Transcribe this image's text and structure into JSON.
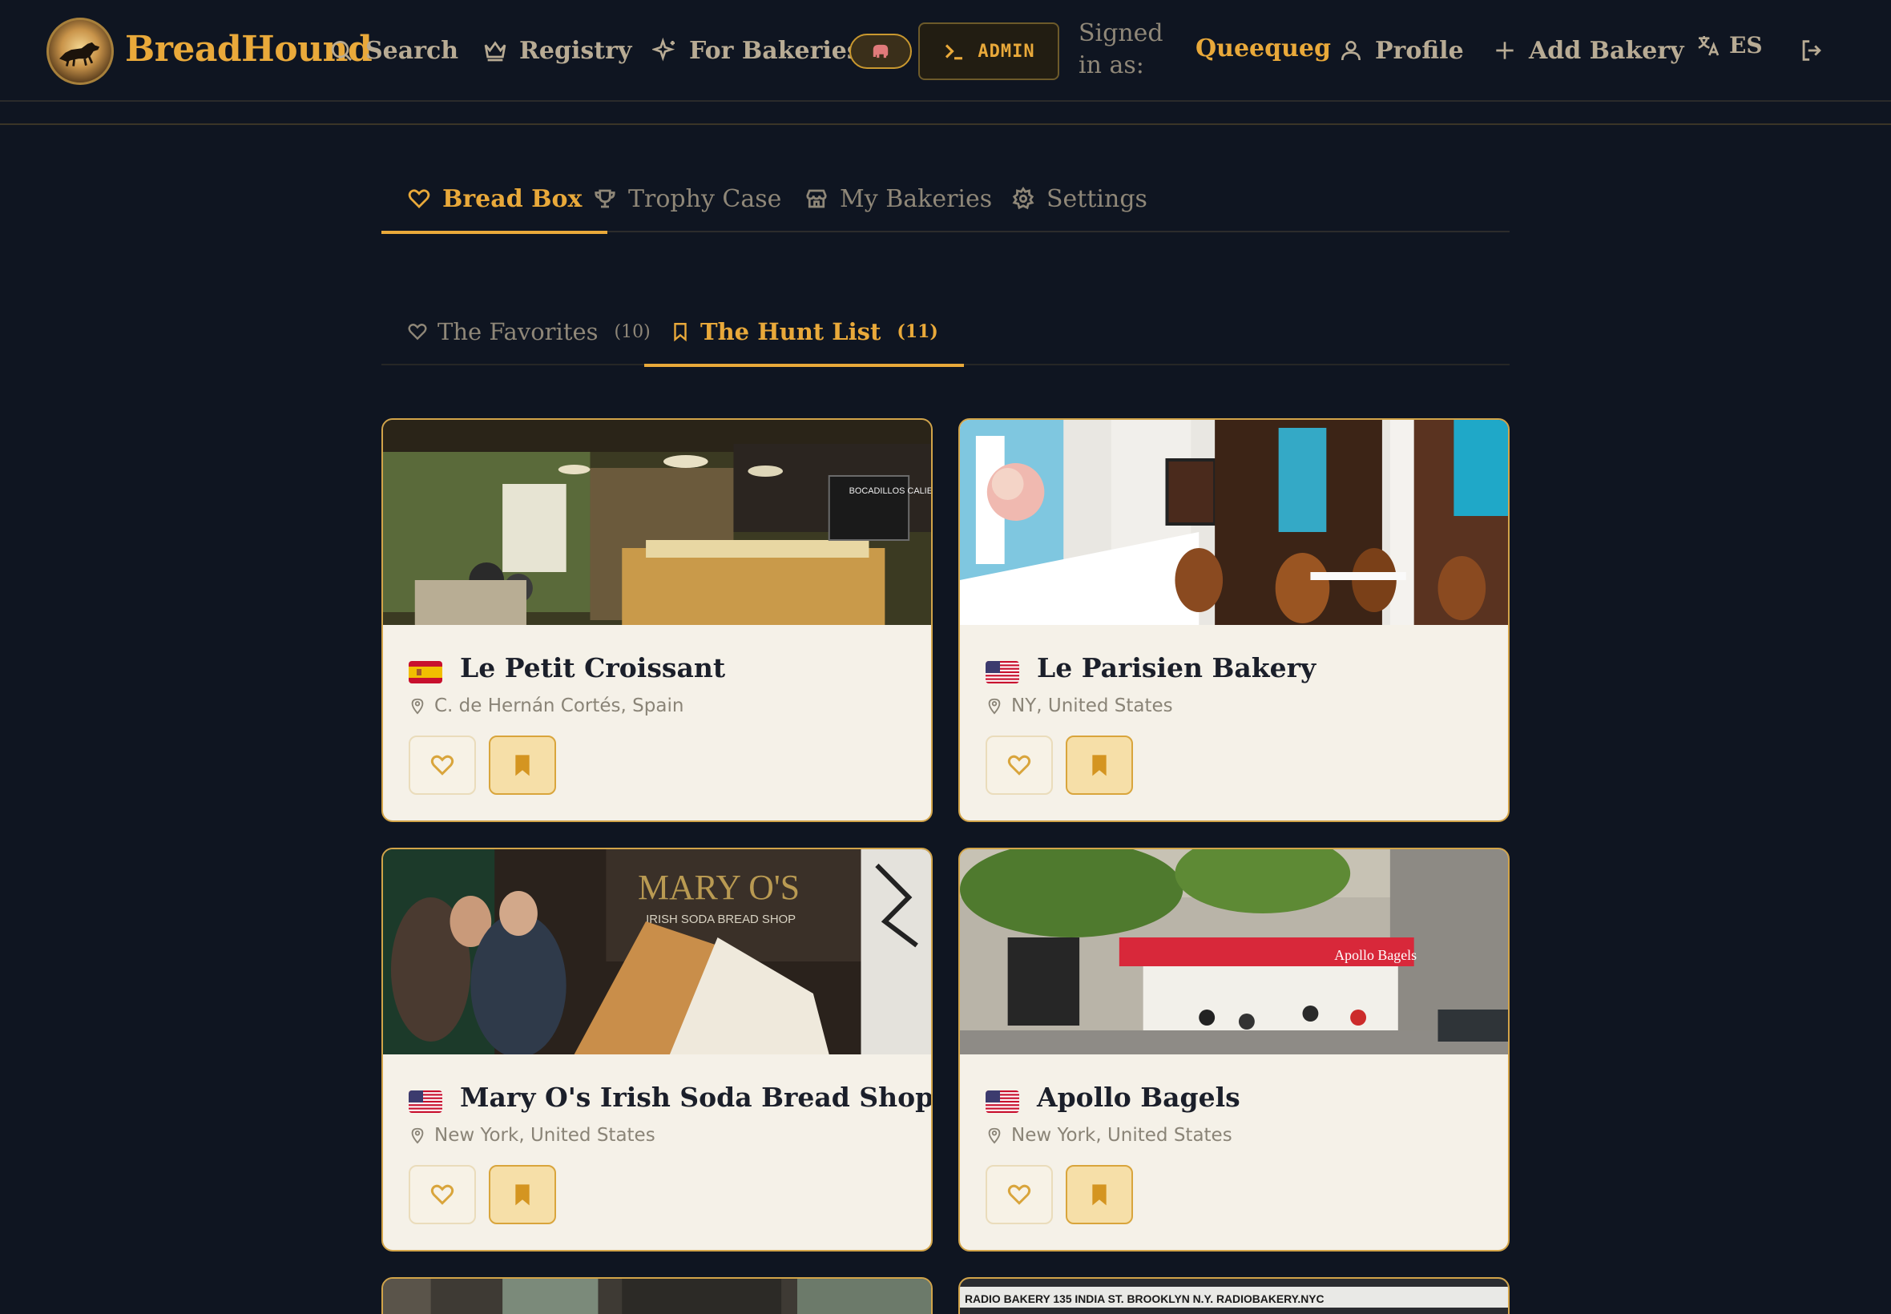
{
  "app": {
    "brand": "BreadHound",
    "accent": "#e9a93a",
    "bg": "#0f1521"
  },
  "nav": {
    "search": "Search",
    "registry": "Registry",
    "for_bakeries": "For Bakeries",
    "admin": "ADMIN",
    "signed_in_label": "Signed in as:",
    "username": "Queequeg",
    "profile": "Profile",
    "add_bakery": "Add Bakery",
    "language": "ES"
  },
  "tabs": [
    {
      "label": "Bread Box",
      "icon": "heart-icon",
      "active": true
    },
    {
      "label": "Trophy Case",
      "icon": "trophy-icon",
      "active": false
    },
    {
      "label": "My Bakeries",
      "icon": "store-icon",
      "active": false
    },
    {
      "label": "Settings",
      "icon": "gear-icon",
      "active": false
    }
  ],
  "subtabs": [
    {
      "label": "The Favorites",
      "count": "(10)",
      "icon": "heart-icon",
      "active": false
    },
    {
      "label": "The Hunt List",
      "count": "(11)",
      "icon": "bookmark-icon",
      "active": true
    }
  ],
  "cards": [
    {
      "name": "Le Petit Croissant",
      "location": "C. de Hernán Cortés, Spain",
      "flag": "spain-flag-icon",
      "favorited": false,
      "hunted": true
    },
    {
      "name": "Le Parisien Bakery",
      "location": "NY, United States",
      "flag": "us-flag-icon",
      "favorited": false,
      "hunted": true
    },
    {
      "name": "Mary O's Irish Soda Bread Shop",
      "location": "New York, United States",
      "flag": "us-flag-icon",
      "favorited": false,
      "hunted": true
    },
    {
      "name": "Apollo Bagels",
      "location": "New York, United States",
      "flag": "us-flag-icon",
      "favorited": false,
      "hunted": true
    }
  ],
  "photo_text": {
    "card1_chalkboard": "BOCADILLOS CALIENTES",
    "card3_sign": "MARY O'S",
    "card3_subsign": "IRISH SODA BREAD SHOP",
    "card4_awning": "Apollo Bagels",
    "peek2_sign": "RADIO BAKERY  135 INDIA ST. BROOKLYN N.Y.  RADIOBAKERY.NYC"
  }
}
